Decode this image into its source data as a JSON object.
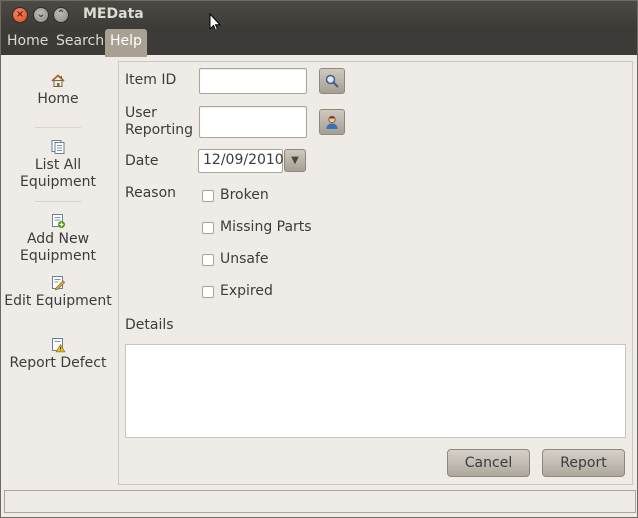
{
  "window": {
    "title": "MEData"
  },
  "menubar": {
    "items": [
      "Home",
      "Search",
      "Help"
    ],
    "active": "Help"
  },
  "sidebar": {
    "items": [
      {
        "label": "Home",
        "icon": "home-icon"
      },
      {
        "label": "List All Equipment",
        "icon": "list-icon"
      },
      {
        "label": "Add New Equipment",
        "icon": "add-document-icon"
      },
      {
        "label": "Edit Equipment",
        "icon": "edit-document-icon"
      },
      {
        "label": "Report Defect",
        "icon": "warning-document-icon"
      }
    ]
  },
  "form": {
    "item_id_label": "Item ID",
    "item_id_value": "",
    "user_reporting_label": "User Reporting",
    "user_reporting_value": "",
    "date_label": "Date",
    "date_value": "12/09/2010",
    "reason_label": "Reason",
    "reasons": [
      {
        "label": "Broken",
        "checked": false
      },
      {
        "label": "Missing Parts",
        "checked": false
      },
      {
        "label": "Unsafe",
        "checked": false
      },
      {
        "label": "Expired",
        "checked": false
      }
    ],
    "details_label": "Details",
    "details_value": ""
  },
  "buttons": {
    "cancel": "Cancel",
    "report": "Report"
  },
  "colors": {
    "titlebar": "#3c3b37",
    "menu_active": "#a9a094",
    "window_bg": "#efebe7",
    "close_button": "#df4a16"
  }
}
